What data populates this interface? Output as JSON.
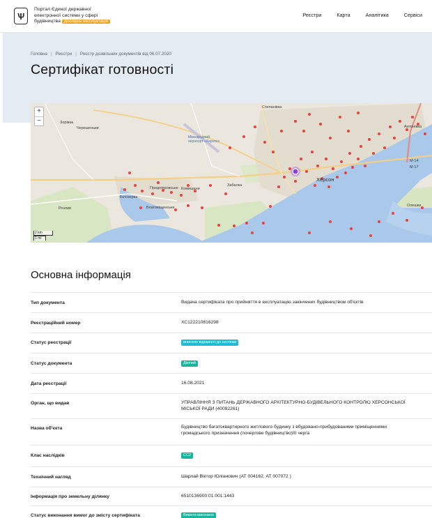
{
  "header": {
    "portal_line1": "Портал Єдиної державної",
    "portal_line2": "електронної системи у сфері",
    "portal_line3": "будівництва",
    "badge": "Дослідна експлуатація",
    "nav": [
      "Реєстри",
      "Карта",
      "Аналітика",
      "Сервіси"
    ]
  },
  "breadcrumb": [
    "Головна",
    "Реєстри",
    "Реєстр дозвільних документів від 06.07.2020"
  ],
  "page_title": "Сертифікат готовності",
  "map": {
    "zoom_in": "+",
    "zoom_out": "−",
    "scale_km": "2 km",
    "scale_mi": "1 mi",
    "labels": {
      "zorivka": "Зорівка",
      "chereshnevka": "Черешеньки",
      "airport": "Міжнародний аеропорт «Херсон»",
      "komyshany": "Комишани",
      "bilozerka": "Білозерка",
      "prydniprovske": "Придніпровське",
      "blagoveshchenske": "Благовіщенське",
      "kherson": "Херсон",
      "antonivka": "Антонівка",
      "oleshky": "Олешки",
      "stepanivka": "Степанівка",
      "zabalka": "Забалка",
      "roshchi": "Розлив",
      "m14": "M-14",
      "m17": "M-17"
    }
  },
  "section_title": "Основна інформація",
  "info": [
    {
      "label": "Тип документа",
      "value": "Видача сертифіката про прийняття в експлуатацію закінчених будівництвом об'єктів"
    },
    {
      "label": "Реєстраційний номер",
      "value": "ХС122210816298"
    },
    {
      "label": "Статус реєстрації",
      "tag": "внесено відомості до системи"
    },
    {
      "label": "Статус документа",
      "tag": "Діючий"
    },
    {
      "label": "Дата реєстрації",
      "value": "16.08.2021"
    },
    {
      "label": "Орган, що видав",
      "value": "УПРАВЛІННЯ З ПИТАНЬ ДЕРЖАВНОГО АРХІТЕКТУРНО-БУДІВЕЛЬНОГО КОНТРОЛЮ ХЕРСОНСЬКОЇ МІСЬКОЇ РАДИ (40092261)"
    },
    {
      "label": "Назва об'єкта",
      "value": "Будівництво багатоквартирного житлового будинку з вбудовано-прибудованими приміщеннями громадського призначення (почергове будівництво)ІІІ черга"
    },
    {
      "label": "Клас наслідків",
      "tag": "СС2"
    },
    {
      "label": "Технічний нагляд",
      "value": "Шарлай Віктор Юліанович (АТ 004162, АТ 007072 )"
    },
    {
      "label": "Інформація про земельну ділянку",
      "value": "6510136900:01:001:1443"
    },
    {
      "label": "Статус виконання вимог до змісту сертифіката",
      "tag": "Вимоги виконано"
    }
  ],
  "colors": {
    "hero_bg": "#e4ebf2",
    "tag_blue": "#1bbdd4",
    "tag_green": "#18b49f",
    "badge_orange": "#f2a21c",
    "marker_red": "#e8413c",
    "marker_selected": "#8a3fe0",
    "water": "#a9c8ea"
  }
}
